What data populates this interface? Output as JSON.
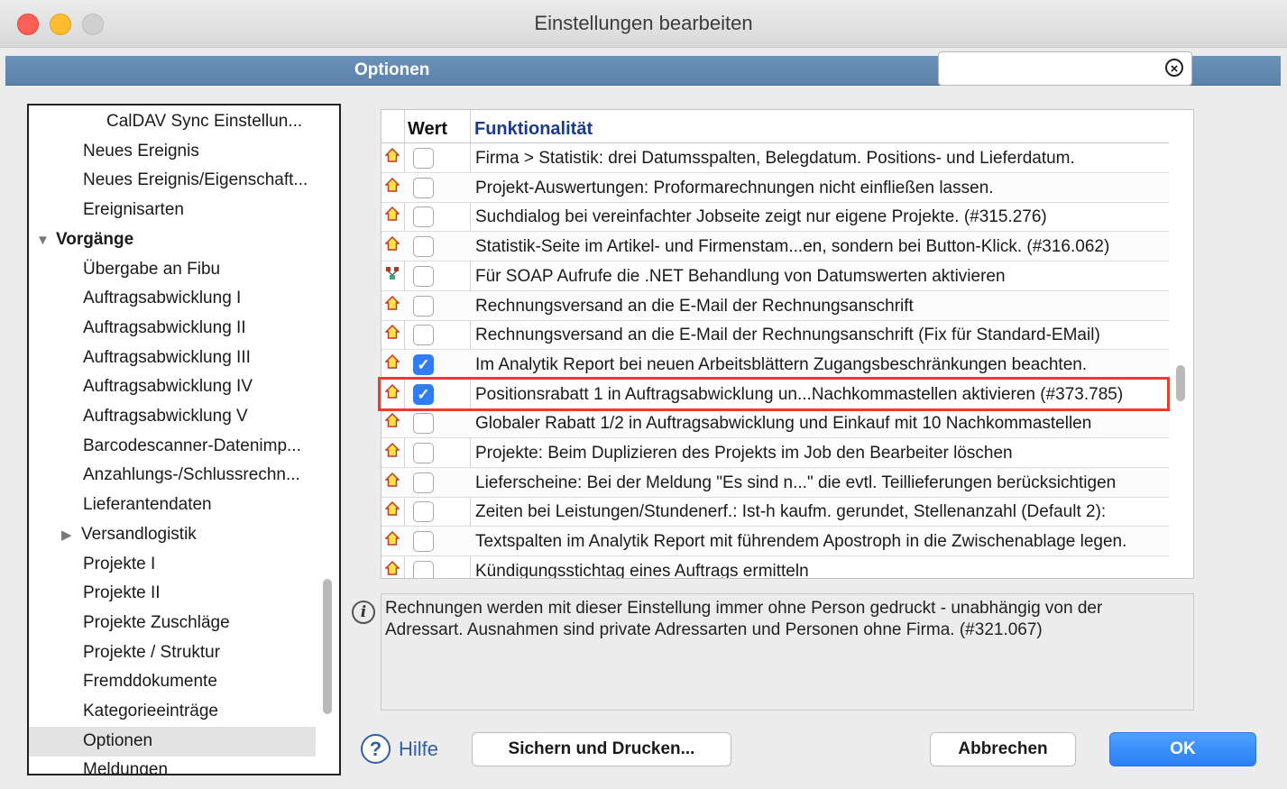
{
  "window": {
    "title": "Einstellungen bearbeiten"
  },
  "header": {
    "title": "Optionen",
    "search_value": "",
    "search_clear_icon": "clear-icon"
  },
  "sidebar": {
    "items": [
      {
        "label": "CalDAV Sync Einstellun...",
        "indent": 2,
        "bold": false
      },
      {
        "label": "Neues Ereignis",
        "indent": 1,
        "bold": false
      },
      {
        "label": "Neues Ereignis/Eigenschaft...",
        "indent": 1,
        "bold": false
      },
      {
        "label": "Ereignisarten",
        "indent": 1,
        "bold": false
      },
      {
        "label": "Vorgänge",
        "indent": 0,
        "bold": true,
        "expanded": true
      },
      {
        "label": "Übergabe an Fibu",
        "indent": 1,
        "bold": false
      },
      {
        "label": "Auftragsabwicklung I",
        "indent": 1,
        "bold": false
      },
      {
        "label": "Auftragsabwicklung II",
        "indent": 1,
        "bold": false
      },
      {
        "label": "Auftragsabwicklung III",
        "indent": 1,
        "bold": false
      },
      {
        "label": "Auftragsabwicklung IV",
        "indent": 1,
        "bold": false
      },
      {
        "label": "Auftragsabwicklung V",
        "indent": 1,
        "bold": false
      },
      {
        "label": "Barcodescanner-Datenimp...",
        "indent": 1,
        "bold": false
      },
      {
        "label": "Anzahlungs-/Schlussrechn...",
        "indent": 1,
        "bold": false
      },
      {
        "label": "Lieferantendaten",
        "indent": 1,
        "bold": false
      },
      {
        "label": "Versandlogistik",
        "indent": 1,
        "bold": false,
        "collapsed": true
      },
      {
        "label": "Projekte I",
        "indent": 1,
        "bold": false
      },
      {
        "label": "Projekte II",
        "indent": 1,
        "bold": false
      },
      {
        "label": "Projekte Zuschläge",
        "indent": 1,
        "bold": false
      },
      {
        "label": "Projekte / Struktur",
        "indent": 1,
        "bold": false
      },
      {
        "label": "Fremddokumente",
        "indent": 1,
        "bold": false
      },
      {
        "label": "Kategorieeinträge",
        "indent": 1,
        "bold": false
      },
      {
        "label": "Optionen",
        "indent": 1,
        "bold": false,
        "selected": true
      },
      {
        "label": "Meldungen",
        "indent": 1,
        "bold": false
      }
    ]
  },
  "table": {
    "col_wert": "Wert",
    "col_func": "Funktionalität",
    "rows": [
      {
        "icon": "home-icon",
        "checked": false,
        "text": "Firma > Statistik: drei Datumsspalten, Belegdatum. Positions- und Lieferdatum."
      },
      {
        "icon": "home-icon",
        "checked": false,
        "text": "Projekt-Auswertungen: Proformarechnungen nicht einfließen lassen."
      },
      {
        "icon": "home-icon",
        "checked": false,
        "text": "Suchdialog bei vereinfachter Jobseite zeigt nur eigene Projekte. (#315.276)"
      },
      {
        "icon": "home-icon",
        "checked": false,
        "text": "Statistik-Seite im Artikel- und Firmenstam...en, sondern bei Button-Klick. (#316.062)"
      },
      {
        "icon": "network-icon",
        "checked": false,
        "text": "Für SOAP Aufrufe die .NET Behandlung von Datumswerten aktivieren"
      },
      {
        "icon": "home-icon",
        "checked": false,
        "text": "Rechnungsversand an die E-Mail der Rechnungsanschrift"
      },
      {
        "icon": "home-icon",
        "checked": false,
        "text": "Rechnungsversand an die E-Mail der Rechnungsanschrift (Fix für Standard-EMail)"
      },
      {
        "icon": "home-icon",
        "checked": true,
        "text": "Im Analytik Report bei neuen Arbeitsblättern Zugangsbeschränkungen beachten."
      },
      {
        "icon": "home-icon",
        "checked": true,
        "text": "Positionsrabatt 1 in Auftragsabwicklung un...Nachkommastellen aktivieren (#373.785)",
        "highlighted": true
      },
      {
        "icon": "home-icon",
        "checked": false,
        "text": "Globaler Rabatt 1/2 in Auftragsabwicklung und Einkauf mit 10 Nachkommastellen"
      },
      {
        "icon": "home-icon",
        "checked": false,
        "text": "Projekte: Beim Duplizieren des Projekts im Job den Bearbeiter löschen"
      },
      {
        "icon": "home-icon",
        "checked": false,
        "text": "Lieferscheine: Bei der Meldung \"Es sind n...\" die evtl. Teillieferungen berücksichtigen"
      },
      {
        "icon": "home-icon",
        "checked": false,
        "text": "Zeiten bei Leistungen/Stundenerf.: Ist-h kaufm. gerundet, Stellenanzahl (Default 2):"
      },
      {
        "icon": "home-icon",
        "checked": false,
        "text": "Textspalten im Analytik Report mit führendem Apostroph in die Zwischenablage legen."
      },
      {
        "icon": "home-icon",
        "checked": false,
        "text": "Kündigungsstichtag eines Auftrags ermitteln"
      }
    ]
  },
  "info": {
    "text": "Rechnungen werden mit dieser Einstellung immer ohne Person gedruckt - unabhängig von der Adressart. Ausnahmen sind private Adressarten und Personen ohne Firma. (#321.067)"
  },
  "footer": {
    "help_label": "Hilfe",
    "print_label": "Sichern und Drucken...",
    "cancel_label": "Abbrechen",
    "ok_label": "OK"
  },
  "colors": {
    "accent": "#2f7cf6",
    "header_bar": "#5f87af",
    "highlight": "#ee3b2b",
    "func_header": "#1a3b8a"
  }
}
